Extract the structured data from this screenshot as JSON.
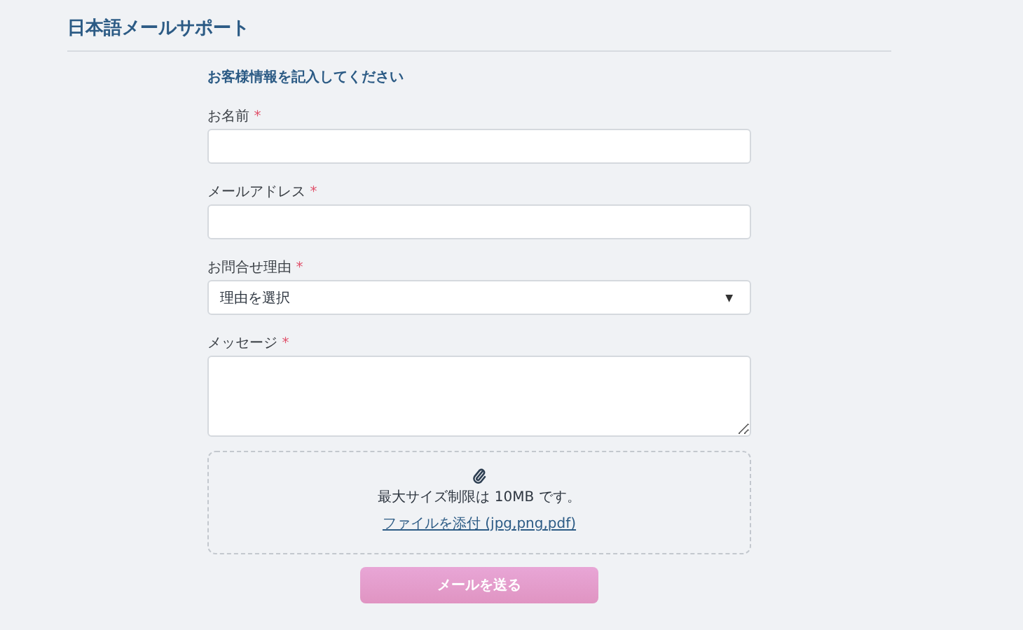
{
  "header": {
    "title": "日本語メールサポート"
  },
  "form": {
    "title": "お客様情報を記入してください",
    "fields": [
      {
        "kind": "text",
        "label": "お名前",
        "mark": "*"
      },
      {
        "kind": "text",
        "label": "メールアドレス",
        "mark": "*"
      },
      {
        "kind": "select",
        "label": "お問合せ理由",
        "mark": "*",
        "value": "理由を選択",
        "caret": "▼"
      },
      {
        "kind": "textarea",
        "label": "メッセージ",
        "mark": "*"
      }
    ],
    "attachment": {
      "note": "最大サイズ制限は 10MB です。",
      "link": "ファイルを添付 (jpg,png,pdf)"
    },
    "submit": {
      "label": "メールを送る",
      "disabled": true
    }
  }
}
